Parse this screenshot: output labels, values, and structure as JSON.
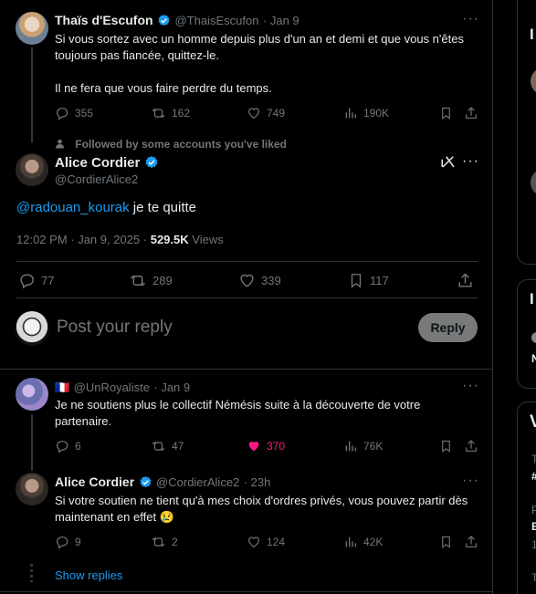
{
  "parent_tweet": {
    "name": "Thaïs d'Escufon",
    "handle": "@ThaisEscufon",
    "date": "· Jan 9",
    "text_line1": "Si vous sortez avec un homme depuis plus d'un an et demi et que vous n'êtes",
    "text_line2": "toujours pas fiancée, quittez-le.",
    "text_line3": "Il ne fera que vous faire perdre du temps.",
    "replies": "355",
    "reposts": "162",
    "likes": "749",
    "views": "190K"
  },
  "main_tweet": {
    "social_context": "Followed by some accounts you've liked",
    "name": "Alice Cordier",
    "handle": "@CordierAlice2",
    "mention": "@radouan_kourak",
    "text": " je te quitte",
    "time": "12:02 PM · Jan 9, 2025 ·",
    "views_count": "529.5K",
    "views_label": "Views",
    "replies": "77",
    "reposts": "289",
    "likes": "339",
    "bookmarks": "117"
  },
  "composer": {
    "placeholder": "Post your reply",
    "reply_label": "Reply"
  },
  "reply1": {
    "flag": "🇫🇷",
    "handle": "@UnRoyaliste",
    "date": "· Jan 9",
    "text_line1": "Je ne soutiens plus le collectif Némésis suite à la découverte de votre",
    "text_line2": "partenaire.",
    "replies": "6",
    "reposts": "47",
    "likes": "370",
    "views": "76K"
  },
  "reply2": {
    "name": "Alice Cordier",
    "handle": "@CordierAlice2",
    "date": "· 23h",
    "text_line1": "Si votre soutien ne tient qu'à mes choix d'ordres privés, vous pouvez partir dès",
    "text_line2": "maintenant en effet",
    "emoji": "😢",
    "replies": "9",
    "reposts": "2",
    "likes": "124",
    "views": "42K"
  },
  "show_replies": "Show replies",
  "sidebar": {
    "letters": [
      "I",
      "I",
      "V"
    ],
    "fragments": [
      "T",
      "#",
      "P",
      "E",
      "1",
      "T"
    ]
  },
  "colors": {
    "background": "#000000",
    "border": "#2f3336",
    "muted": "#71767b",
    "accent": "#1d9bf0",
    "like_active": "#f91880"
  }
}
